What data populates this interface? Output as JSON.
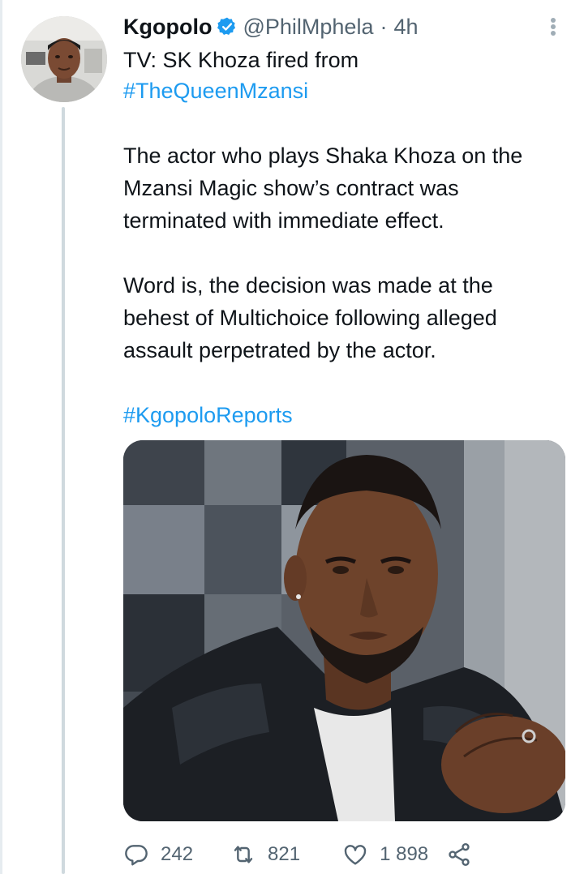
{
  "tweet": {
    "author": {
      "display_name": "Kgopolo",
      "handle": "@PhilMphela",
      "verified": true,
      "avatar_icon": "profile-photo-man"
    },
    "separator": "·",
    "time": "4h",
    "headline_line1": "TV: SK Khoza fired from",
    "headline_hashtag": "#TheQueenMzansi",
    "paragraph1": [
      "The actor who plays Shaka Khoza on the",
      "Mzansi Magic show’s contract was",
      "terminated with immediate effect."
    ],
    "paragraph2": [
      "Word is, the decision was made at the",
      "behest of Multichoice following alleged",
      "assault perpetrated by the actor."
    ],
    "footer_hashtag": "#KgopoloReports",
    "media": {
      "icon": "photo-man-leather-jacket"
    },
    "metrics": {
      "replies": "242",
      "retweets": "821",
      "likes": "1 898"
    }
  },
  "colors": {
    "link": "#1d9bf0",
    "secondary_text": "#536471",
    "verified_badge": "#1d9bf0",
    "thread_line": "#cfd9de"
  }
}
